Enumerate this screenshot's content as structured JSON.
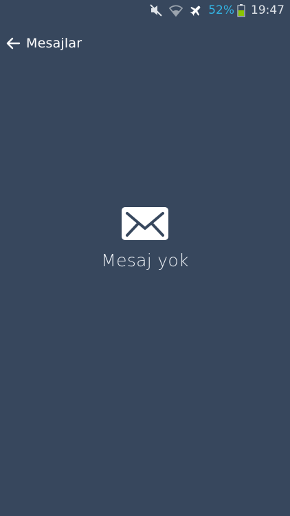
{
  "status_bar": {
    "battery_percent": "52%",
    "time": "19:47",
    "icons": [
      "mute-icon",
      "wifi-icon",
      "airplane-mode-icon",
      "battery-icon"
    ],
    "battery_color": "#8bc400",
    "battery_text_color": "#33b5e5"
  },
  "app_bar": {
    "back_icon": "arrow-left-icon",
    "title": "Mesajlar"
  },
  "empty_state": {
    "icon": "envelope-icon",
    "message": "Mesaj yok"
  },
  "colors": {
    "background": "#37475d",
    "text": "#ffffff"
  }
}
